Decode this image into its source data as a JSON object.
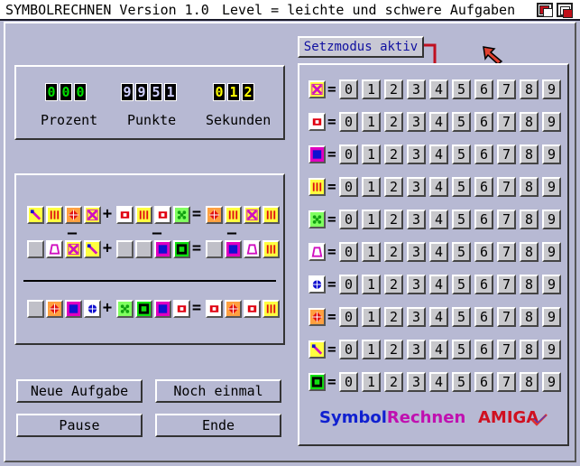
{
  "window": {
    "title": "SYMBOLRECHNEN Version 1.0",
    "level_text": "Level = leichte und schwere Aufgaben"
  },
  "stats": {
    "percent": {
      "label": "Prozent",
      "digits": [
        "0",
        "0",
        "0"
      ],
      "color": "#00e000"
    },
    "points": {
      "label": "Punkte",
      "digits": [
        "9",
        "9",
        "5",
        "1"
      ],
      "color": "#d0d0ff"
    },
    "seconds": {
      "label": "Sekunden",
      "digits": [
        "0",
        "1",
        "2"
      ],
      "color": "#ffff00"
    }
  },
  "buttons": {
    "new_task": "Neue Aufgabe",
    "again": "Noch einmal",
    "pause": "Pause",
    "end": "Ende"
  },
  "mode_label": "Setzmodus aktiv",
  "operators": {
    "plus": "+",
    "minus": "–",
    "equals": "="
  },
  "number_buttons": [
    "0",
    "1",
    "2",
    "3",
    "4",
    "5",
    "6",
    "7",
    "8",
    "9"
  ],
  "symbols": [
    {
      "name": "x-magenta-icon",
      "color": "#d010c0",
      "bg": "#ffff40"
    },
    {
      "name": "red-dot-icon",
      "color": "#e00010",
      "bg": "#ffffff"
    },
    {
      "name": "blue-square-icon",
      "color": "#1010d0",
      "bg": "#e000c0"
    },
    {
      "name": "red-bars-icon",
      "color": "#e01010",
      "bg": "#ffff40"
    },
    {
      "name": "green-dots-icon",
      "color": "#10a010",
      "bg": "#80ff60"
    },
    {
      "name": "magenta-trapezoid-icon",
      "color": "#d010c0",
      "bg": "#ffffff"
    },
    {
      "name": "blue-flower-icon",
      "color": "#1010d0",
      "bg": "#ffffff"
    },
    {
      "name": "red-diamond-icon",
      "color": "#e01010",
      "bg": "#ffa040"
    },
    {
      "name": "pencil-icon",
      "color": "#d010c0",
      "bg": "#ffff40"
    },
    {
      "name": "green-square-icon",
      "color": "#10a010",
      "bg": "#10e010"
    }
  ],
  "footer": {
    "symbol": "Symbol",
    "rechnen": "Rechnen",
    "amiga": "AMIGA",
    "symbol_color": "#1020d0",
    "rechnen_color": "#c010b0",
    "amiga_color": "#d01020"
  }
}
